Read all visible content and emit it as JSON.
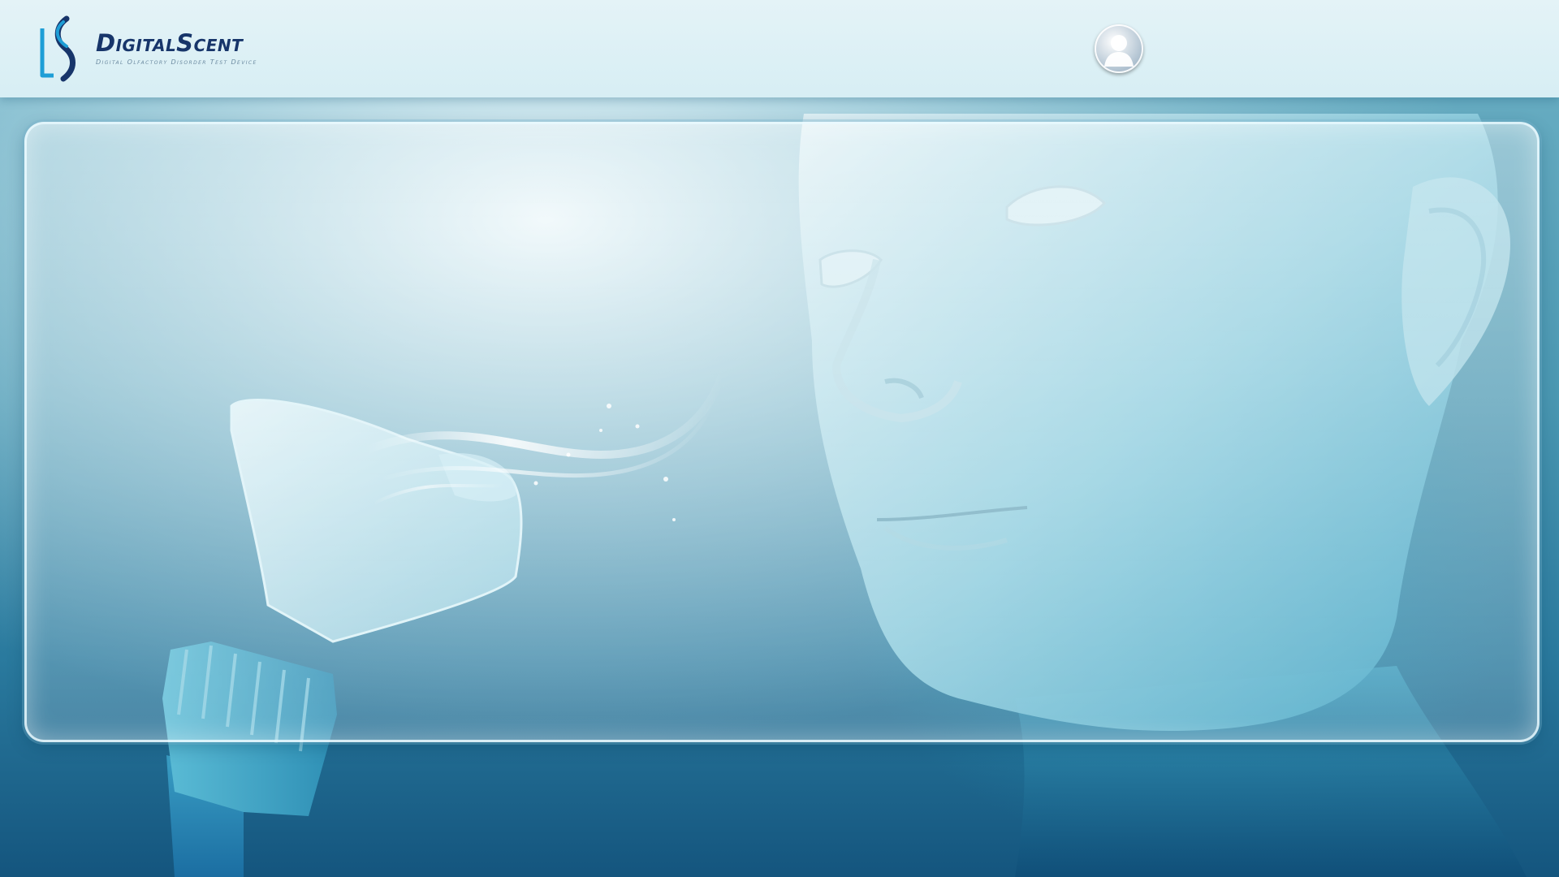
{
  "header": {
    "brand": "DigitalScent",
    "tagline": "Digital Olfactory Disorder Test Device"
  },
  "user": {
    "avatar_icon": "user-avatar-icon"
  },
  "colors": {
    "header_bg": "#dcf0f5",
    "brand_navy": "#17356a",
    "logo_blue": "#1e9ed6",
    "background_teal": "#4b98b2"
  }
}
